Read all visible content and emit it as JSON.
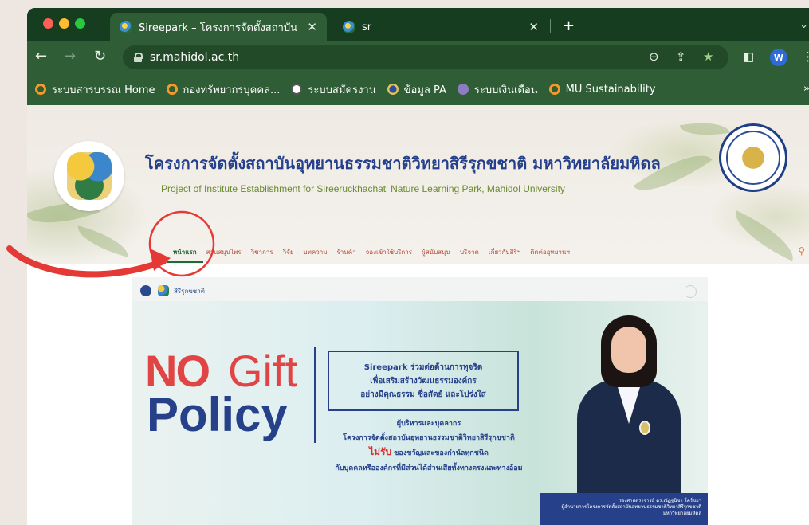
{
  "browser": {
    "tabs": [
      {
        "title": "Sireepark – โครงการจัดตั้งสถาบัน",
        "active": true
      },
      {
        "title": "sr",
        "active": false
      }
    ],
    "url": "sr.mahidol.ac.th",
    "profile_initial": "W",
    "bookmarks": [
      {
        "label": "ระบบสารบรรณ Home",
        "icon": "orange-circle-icon"
      },
      {
        "label": "กองทรัพยากรบุคคล...",
        "icon": "orange-circle-icon"
      },
      {
        "label": "ระบบสมัครงาน",
        "icon": "globe-icon"
      },
      {
        "label": "ข้อมูล PA",
        "icon": "seal-icon"
      },
      {
        "label": "ระบบเงินเดือน",
        "icon": "pay-icon"
      },
      {
        "label": "MU Sustainability",
        "icon": "orange-circle-icon"
      }
    ],
    "bookmarks_more": "»"
  },
  "site": {
    "title_th": "โครงการจัดตั้งสถาบันอุทยานธรรมชาติวิทยาสิรีรุกขชาติ มหาวิทยาลัยมหิดล",
    "title_en": "Project of Institute Establishment for Sireeruckhachati Nature Learning Park, Mahidol University",
    "menu": [
      {
        "label": "หน้าแรก",
        "active": true
      },
      {
        "label": "สวนสมุนไพร"
      },
      {
        "label": "วิชาการ"
      },
      {
        "label": "วิจัย"
      },
      {
        "label": "บทความ"
      },
      {
        "label": "ร้านค้า"
      },
      {
        "label": "จองเข้าใช้บริการ"
      },
      {
        "label": "ผู้สนับสนุน"
      },
      {
        "label": "บริจาค"
      },
      {
        "label": "เกี่ยวกับสิรีฯ"
      },
      {
        "label": "ติดต่ออุทยานฯ"
      }
    ]
  },
  "hero": {
    "mini_logo_text": "สิรีรุกขชาติ",
    "no": "NO",
    "gift": "Gift",
    "policy": "Policy",
    "box_lines": [
      "Sireepark ร่วมต่อต้านการทุจริต",
      "เพื่อเสริมสร้างวัฒนธรรมองค์กร",
      "อย่างมีคุณธรรม ซื่อสัตย์ และโปร่งใส"
    ],
    "staff_line": "ผู้บริหารและบุคลากร",
    "org_line": "โครงการจัดตั้งสถาบันอุทยานธรรมชาติวิทยาสิรีรุกขชาติ",
    "reject_word": "ไม่รับ",
    "reject_rest": " ของขวัญและของกำนัลทุกชนิด",
    "final_line": "กับบุคคลหรือองค์กรที่มีส่วนได้ส่วนเสียทั้งทางตรงและทางอ้อม",
    "caption_line1": "รองศาสตราจารย์ ดร.ณัฏฐนิชา โคร์ชยา",
    "caption_line2": "ผู้อำนวยการโครงการจัดตั้งสถาบันอุทยานธรรมชาติวิทยาสิรีรุกขชาติ",
    "caption_line3": "มหาวิทยาลัยมหิดล"
  },
  "colors": {
    "chrome_green": "#2f5d36",
    "title_blue": "#243f8c",
    "menu_orange": "#b4452f",
    "annotation_red": "#e53935"
  }
}
